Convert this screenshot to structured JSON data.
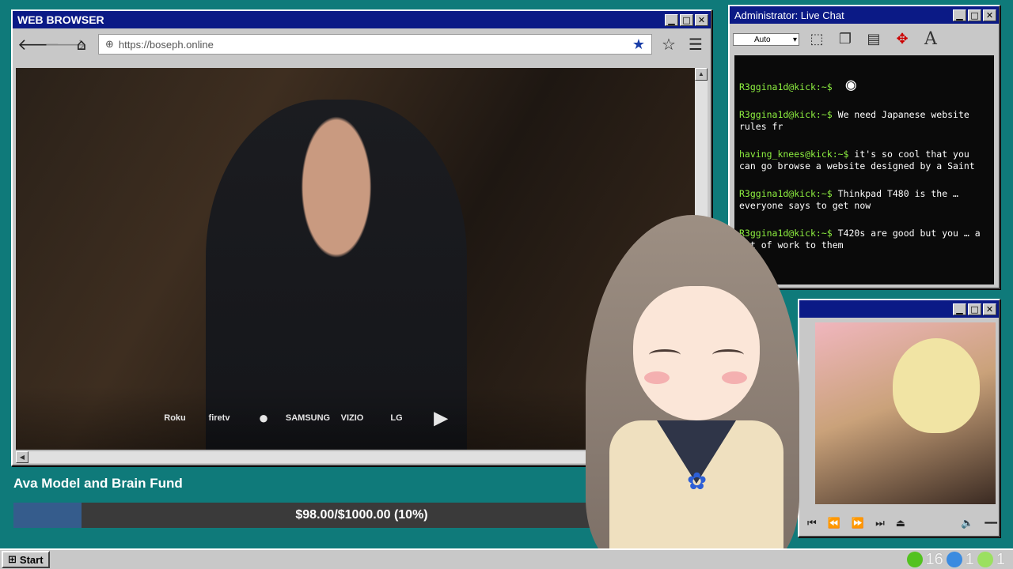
{
  "browser": {
    "title": "WEB BROWSER",
    "url": "https://boseph.online",
    "stream_logos": [
      "Roku",
      "firetv",
      "",
      "SAMSUNG",
      "VIZIO",
      "LG",
      ""
    ]
  },
  "chat": {
    "title": "Administrator: Live Chat",
    "select_value": "Auto",
    "messages": [
      {
        "user": "R3ggina1d@kick:~$",
        "text": ""
      },
      {
        "user": "R3ggina1d@kick:~$",
        "text": "We need Japanese website rules fr"
      },
      {
        "user": "having_knees@kick:~$",
        "text": "it's so cool that you can go browse a website designed by a Saint"
      },
      {
        "user": "R3ggina1d@kick:~$",
        "text": "Thinkpad T480 is the … everyone says to get now"
      },
      {
        "user": "R3ggina1d@kick:~$",
        "text": "T420s are good but you … a lot of work to them"
      }
    ]
  },
  "fund": {
    "title": "Ava Model and Brain Fund",
    "progress_text": "$98.00/$1000.00 (10%)",
    "fraction": 0.098
  },
  "taskbar": {
    "start_label": "Start",
    "tray_counts": [
      "16",
      "1",
      "1"
    ]
  },
  "colors": {
    "desktop": "#0f7a7a",
    "titlebar": "#0b1a86",
    "chat_user": "#8ef040",
    "fund_fill": "#355c8c"
  }
}
